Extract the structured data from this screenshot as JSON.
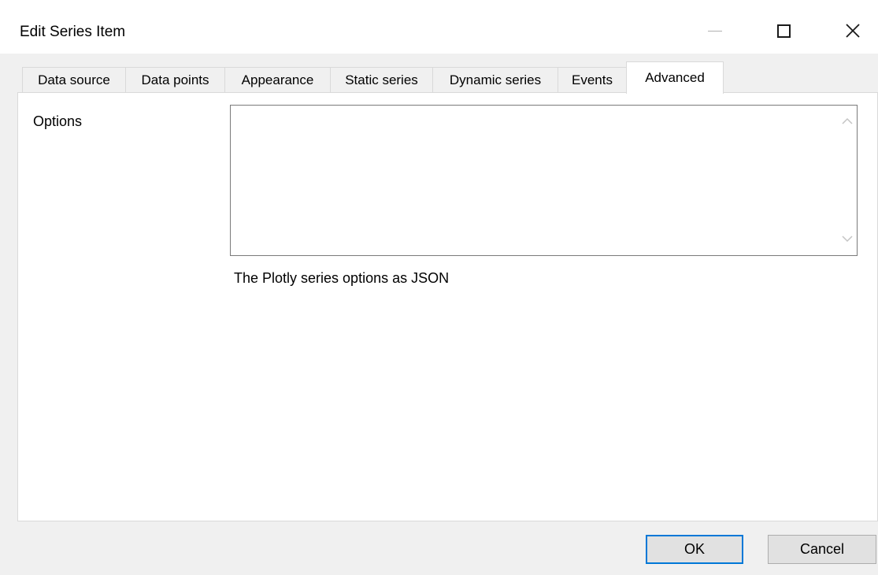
{
  "window": {
    "title": "Edit Series Item"
  },
  "tabs": [
    {
      "label": "Data source"
    },
    {
      "label": "Data points"
    },
    {
      "label": "Appearance"
    },
    {
      "label": "Static series"
    },
    {
      "label": "Dynamic series"
    },
    {
      "label": "Events"
    },
    {
      "label": "Advanced"
    }
  ],
  "active_tab": "Advanced",
  "advanced": {
    "options_label": "Options",
    "options_value": "",
    "options_description": "The Plotly series options as JSON"
  },
  "buttons": {
    "ok_label": "OK",
    "cancel_label": "Cancel"
  },
  "colors": {
    "focus_border": "#0078d7",
    "window_bg": "#f0f0f0",
    "panel_bg": "#ffffff"
  },
  "icons": {
    "minimize": "minimize-icon",
    "maximize": "maximize-icon",
    "close": "close-icon",
    "scroll_up": "chevron-up-icon",
    "scroll_down": "chevron-down-icon"
  }
}
